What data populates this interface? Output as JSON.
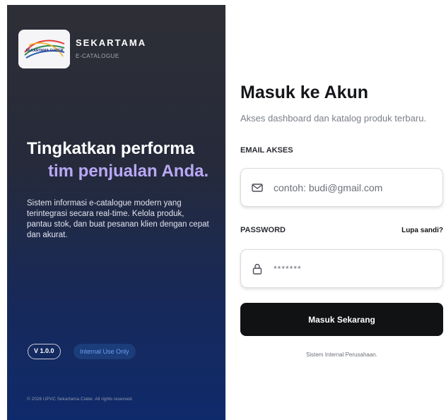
{
  "brand": {
    "logo_text": "SEKARTAMA CIATER",
    "name": "SEKARTAMA",
    "subtitle": "E-CATALOGUE"
  },
  "hero": {
    "line1": "Tingkatkan performa",
    "line2": "tim penjualan Anda.",
    "description": "Sistem informasi e-catalogue modern yang terintegrasi secara real-time. Kelola produk, pantau stok, dan buat pesanan klien dengan cepat dan akurat."
  },
  "badges": {
    "version": "V 1.0.0",
    "internal": "Internal Use Only"
  },
  "copyright": "© 2026 UPVC Sekartama Ciater. All rights reserved.",
  "login": {
    "title": "Masuk ke Akun",
    "subtitle": "Akses dashboard dan katalog produk terbaru.",
    "email_label": "EMAIL AKSES",
    "email_placeholder": "contoh: budi@gmail.com",
    "email_icon": "mail-icon",
    "password_label": "PASSWORD",
    "forgot_label": "Lupa sandi?",
    "password_placeholder": "*******",
    "password_icon": "lock-icon",
    "submit_label": "Masuk Sekarang",
    "footer_note": "Sistem Internal Perusahaan."
  },
  "colors": {
    "panel_dark": "#2e2f36",
    "panel_blue": "#0f2a6b",
    "accent_purple": "#b9a8f5",
    "badge_blue": "#6f9cf0",
    "button": "#111214"
  }
}
